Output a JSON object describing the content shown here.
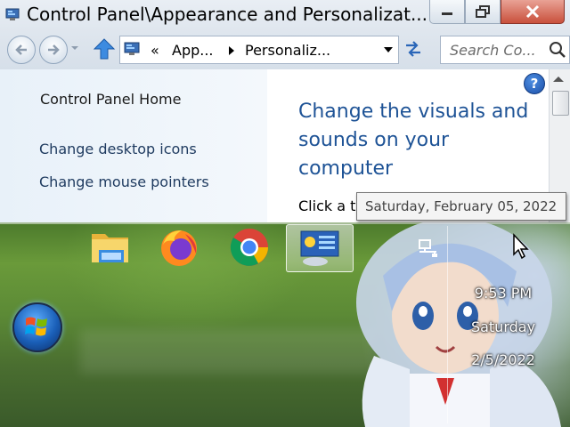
{
  "window": {
    "title": "Control Panel\\Appearance and Personalizat...",
    "breadcrumb": [
      "«",
      "App...",
      "Personaliz..."
    ],
    "search_placeholder": "Search Co...",
    "help_symbol": "?"
  },
  "left_pane": {
    "home_link": "Control Panel Home",
    "links": [
      "Change desktop icons",
      "Change mouse pointers"
    ]
  },
  "content": {
    "heading": "Change the visuals and sounds on your computer",
    "body": "Click a th"
  },
  "tooltip": "Saturday, February 05, 2022",
  "taskbar": {
    "apps": [
      "file-explorer",
      "firefox",
      "chrome",
      "control-panel"
    ],
    "clock": {
      "time": "9:53 PM",
      "day": "Saturday",
      "date": "2/5/2022"
    }
  },
  "colors": {
    "link": "#1e3a5f",
    "heading": "#1e5396",
    "close_button": "#c9503c"
  }
}
